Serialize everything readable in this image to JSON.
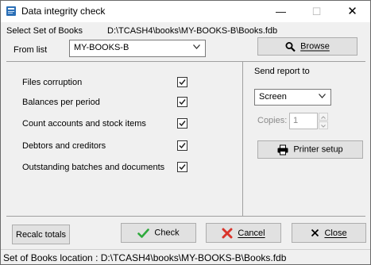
{
  "window": {
    "title": "Data integrity check",
    "minimize": "—",
    "maximize": "☐",
    "close": "✕"
  },
  "books": {
    "select_label": "Select Set of Books",
    "path": "D:\\TCASH4\\books\\MY-BOOKS-B\\Books.fdb",
    "from_list_label": "From list",
    "from_list_value": "MY-BOOKS-B",
    "browse_label": "Browse"
  },
  "checks": [
    {
      "label": "Files corruption",
      "checked": true
    },
    {
      "label": "Balances per period",
      "checked": true
    },
    {
      "label": "Count accounts and stock items",
      "checked": true
    },
    {
      "label": "Debtors and creditors",
      "checked": true
    },
    {
      "label": "Outstanding batches and documents",
      "checked": true
    }
  ],
  "report": {
    "send_label": "Send report to",
    "destination": "Screen",
    "copies_label": "Copies:",
    "copies_value": "1",
    "printer_setup_label": "Printer setup"
  },
  "buttons": {
    "recalc": "Recalc totals",
    "check": "Check",
    "cancel": "Cancel",
    "close": "Close"
  },
  "status": {
    "text": "Set of Books location : D:\\TCASH4\\books\\MY-BOOKS-B\\Books.fdb"
  },
  "colors": {
    "check_green": "#2eaa3c",
    "cancel_red": "#d9342b"
  }
}
